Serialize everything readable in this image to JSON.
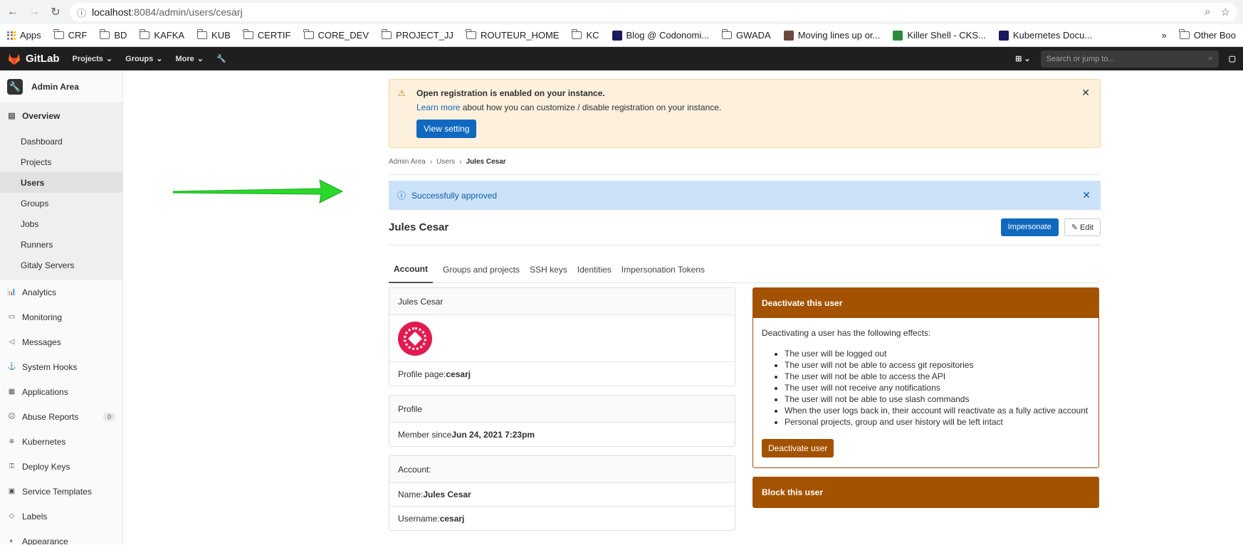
{
  "browser": {
    "url_host": "localhost",
    "url_path": ":8084/admin/users/cesarj",
    "bookmarks": [
      {
        "label": "Apps",
        "icon": "apps-grid-icon"
      },
      {
        "label": "CRF",
        "icon": "folder-icon"
      },
      {
        "label": "BD",
        "icon": "folder-icon"
      },
      {
        "label": "KAFKA",
        "icon": "folder-icon"
      },
      {
        "label": "KUB",
        "icon": "folder-icon"
      },
      {
        "label": "CERTIF",
        "icon": "folder-icon"
      },
      {
        "label": "CORE_DEV",
        "icon": "folder-icon"
      },
      {
        "label": "PROJECT_JJ",
        "icon": "folder-icon"
      },
      {
        "label": "ROUTEUR_HOME",
        "icon": "folder-icon"
      },
      {
        "label": "KC",
        "icon": "folder-icon"
      },
      {
        "label": "Blog @ Codonomi...",
        "icon": "favicon"
      },
      {
        "label": "GWADA",
        "icon": "folder-icon"
      },
      {
        "label": "Moving lines up or...",
        "icon": "favicon"
      },
      {
        "label": "Killer Shell - CKS...",
        "icon": "favicon"
      },
      {
        "label": "Kubernetes Docu...",
        "icon": "favicon"
      }
    ],
    "overflow": "»",
    "other_bookmarks": "Other Boo"
  },
  "header": {
    "brand": "GitLab",
    "nav": [
      "Projects",
      "Groups",
      "More"
    ],
    "search_placeholder": "Search or jump to..."
  },
  "sidebar": {
    "title": "Admin Area",
    "overview": "Overview",
    "sub_items": [
      "Dashboard",
      "Projects",
      "Users",
      "Groups",
      "Jobs",
      "Runners",
      "Gitaly Servers"
    ],
    "active_sub": "Users",
    "items": [
      {
        "label": "Analytics",
        "icon": "chart-icon"
      },
      {
        "label": "Monitoring",
        "icon": "monitor-icon"
      },
      {
        "label": "Messages",
        "icon": "megaphone-icon"
      },
      {
        "label": "System Hooks",
        "icon": "hook-icon"
      },
      {
        "label": "Applications",
        "icon": "apps-icon"
      },
      {
        "label": "Abuse Reports",
        "icon": "abuse-icon",
        "count": "0"
      },
      {
        "label": "Kubernetes",
        "icon": "kubernetes-icon"
      },
      {
        "label": "Deploy Keys",
        "icon": "key-icon"
      },
      {
        "label": "Service Templates",
        "icon": "template-icon"
      },
      {
        "label": "Labels",
        "icon": "label-icon"
      },
      {
        "label": "Appearance",
        "icon": "appearance-icon"
      }
    ]
  },
  "warning_alert": {
    "title": "Open registration is enabled on your instance.",
    "link": "Learn more",
    "body": " about how you can customize / disable registration on your instance.",
    "button": "View setting"
  },
  "breadcrumb": [
    "Admin Area",
    "Users",
    "Jules Cesar"
  ],
  "info_alert": "Successfully approved",
  "user": {
    "name": "Jules Cesar",
    "impersonate": "Impersonate",
    "edit": "Edit"
  },
  "tabs": [
    "Account",
    "Groups and projects",
    "SSH keys",
    "Identities",
    "Impersonation Tokens"
  ],
  "profile_card": {
    "header": "Jules Cesar",
    "profile_page_label": "Profile page: ",
    "profile_page_value": "cesarj"
  },
  "profile_section": {
    "header": "Profile",
    "member_since_label": "Member since ",
    "member_since_value": "Jun 24, 2021 7:23pm"
  },
  "account_section": {
    "header": "Account:",
    "name_label": "Name: ",
    "name_value": "Jules Cesar",
    "username_label": "Username: ",
    "username_value": "cesarj"
  },
  "deactivate": {
    "title": "Deactivate this user",
    "intro": "Deactivating a user has the following effects:",
    "effects": [
      "The user will be logged out",
      "The user will not be able to access git repositories",
      "The user will not be able to access the API",
      "The user will not receive any notifications",
      "The user will not be able to use slash commands",
      "When the user logs back in, their account will reactivate as a fully active account",
      "Personal projects, group and user history will be left intact"
    ],
    "button": "Deactivate user"
  },
  "block": {
    "title": "Block this user"
  }
}
